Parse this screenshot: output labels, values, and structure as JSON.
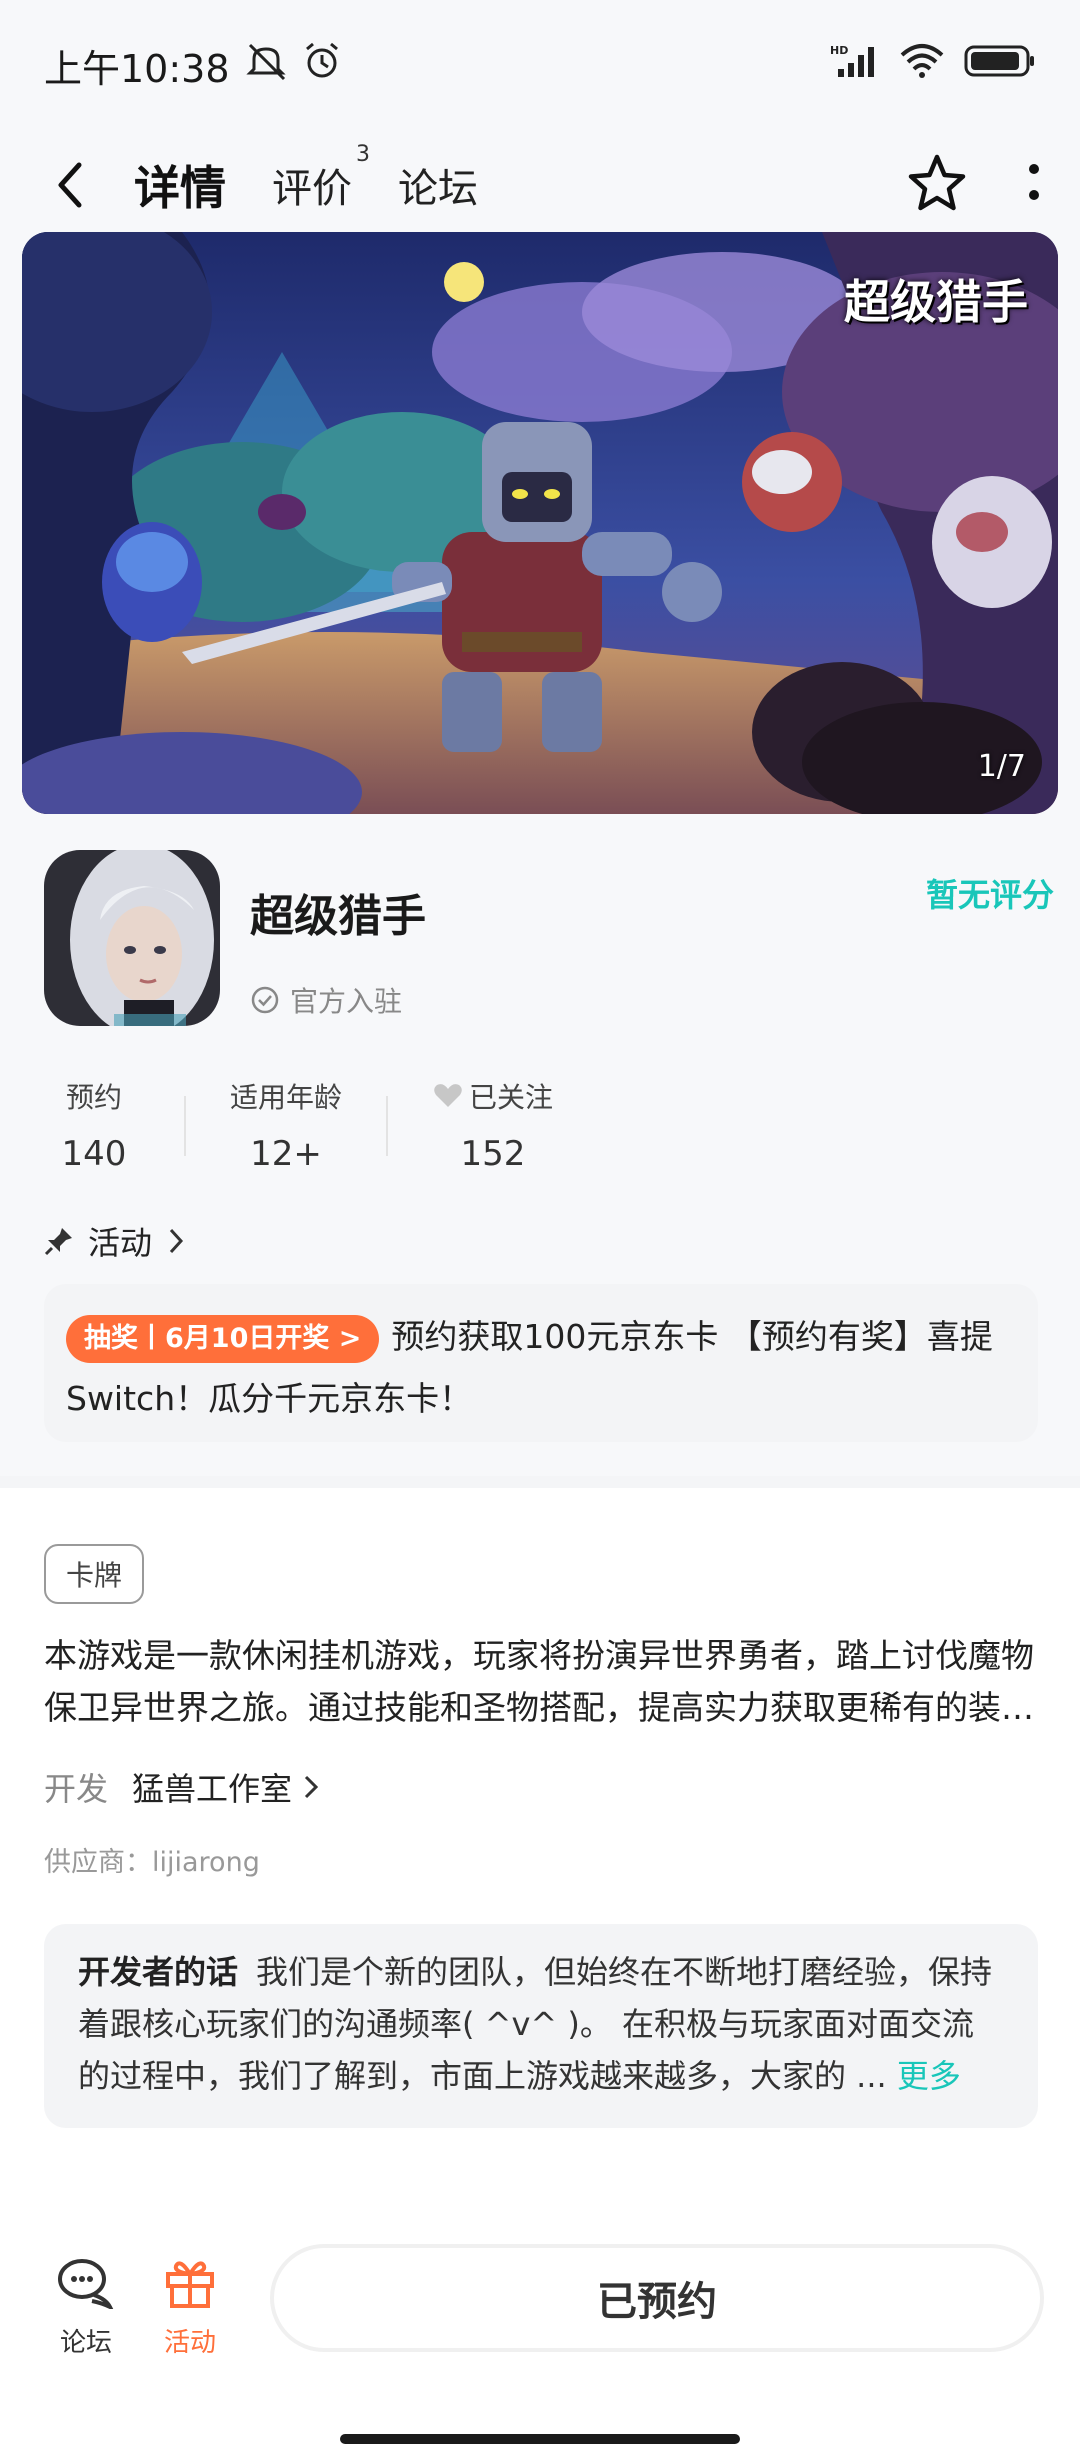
{
  "status_bar": {
    "time": "上午10:38",
    "network": "HD"
  },
  "nav": {
    "tabs": [
      {
        "label": "详情",
        "active": true
      },
      {
        "label": "评价",
        "badge": "3"
      },
      {
        "label": "论坛"
      }
    ]
  },
  "banner": {
    "title": "超级猎手",
    "counter": "1/7"
  },
  "app": {
    "name": "超级猎手",
    "official": "官方入驻",
    "rating": "暂无评分"
  },
  "stats": [
    {
      "label": "预约",
      "value": "140"
    },
    {
      "label": "适用年龄",
      "value": "12+"
    },
    {
      "label": "已关注",
      "value": "152"
    }
  ],
  "activity": {
    "header": "活动",
    "badge": "抽奖丨6月10日开奖 >",
    "text": "预约获取100元京东卡 【预约有奖】喜提Switch！瓜分千元京东卡！"
  },
  "details": {
    "tag": "卡牌",
    "description": "本游戏是一款休闲挂机游戏，玩家将扮演异世界勇者，踏上讨伐魔物保卫异世界之旅。通过技能和圣物搭配，提高实力获取更稀有的装备，击败更强大的敌人。",
    "developer_label": "开发",
    "developer_name": "猛兽工作室",
    "supplier": "供应商：lijiarong"
  },
  "developer_words": {
    "title": "开发者的话",
    "text": "我们是个新的团队，但始终在不断地打磨经验，保持着跟核心玩家们的沟通频率( ^v^ )。 在积极与玩家面对面交流的过程中，我们了解到，市面上游戏越来越多，大家的 ...",
    "more": "更多"
  },
  "bottom_bar": {
    "forum_label": "论坛",
    "activity_label": "活动",
    "reserve_label": "已预约"
  },
  "colors": {
    "accent": "#19c6b9",
    "orange": "#ff6f3a"
  }
}
